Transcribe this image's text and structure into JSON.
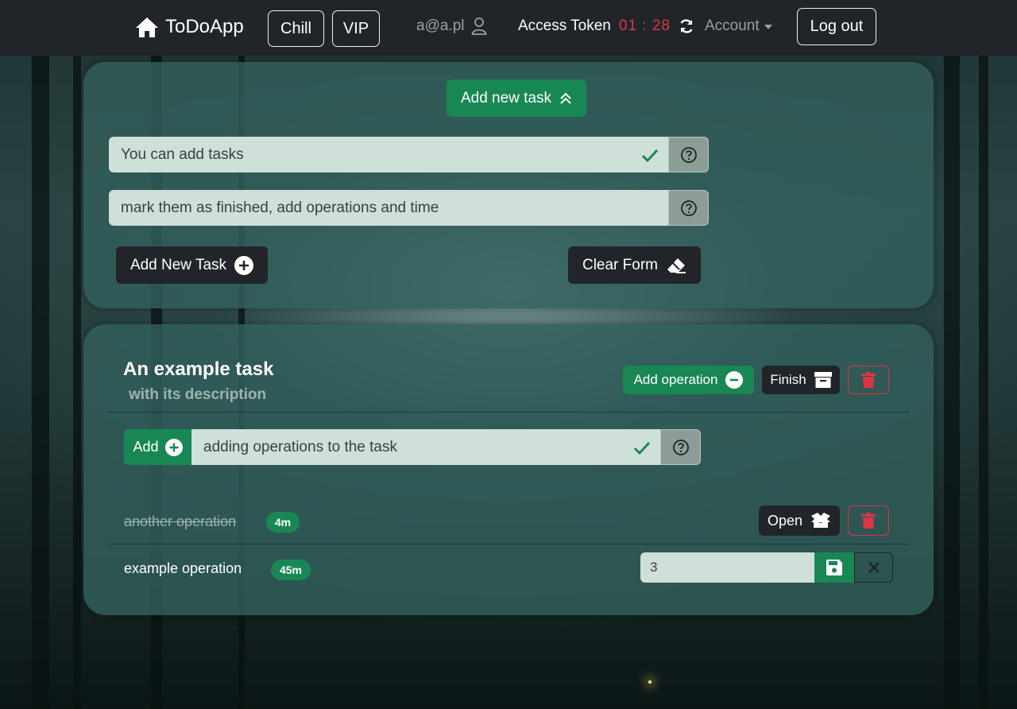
{
  "navbar": {
    "brand": "ToDoApp",
    "chill_label": "Chill",
    "vip_label": "VIP",
    "user_email": "a@a.pl",
    "token_label": "Access Token",
    "token_timer": "01 : 28",
    "account_label": "Account",
    "logout_label": "Log out"
  },
  "new_task_form": {
    "toggle_label": "Add new task",
    "title_value": "You can add tasks",
    "description_value": "mark them as finished, add operations and time",
    "add_button_label": "Add New Task",
    "clear_button_label": "Clear Form"
  },
  "task": {
    "title": "An example task",
    "description": "with its description",
    "add_operation_label": "Add operation",
    "finish_label": "Finish",
    "operation_form": {
      "add_label": "Add",
      "value": "adding operations to the task"
    },
    "operations": [
      {
        "name": "another operation",
        "time": "4m",
        "finished": true,
        "open_label": "Open"
      },
      {
        "name": "example operation",
        "time": "45m",
        "finished": false,
        "time_input_value": "3"
      }
    ]
  },
  "colors": {
    "accent_green": "#198754",
    "danger_red": "#dc3545",
    "navbar_bg": "#212529"
  },
  "icons": [
    "home-icon",
    "user-icon",
    "refresh-icon",
    "chevron-double-up-icon",
    "check-icon",
    "question-circle-icon",
    "plus-circle-icon",
    "eraser-icon",
    "minus-circle-icon",
    "archive-icon",
    "trash-icon",
    "box-open-icon",
    "save-icon",
    "close-icon"
  ]
}
